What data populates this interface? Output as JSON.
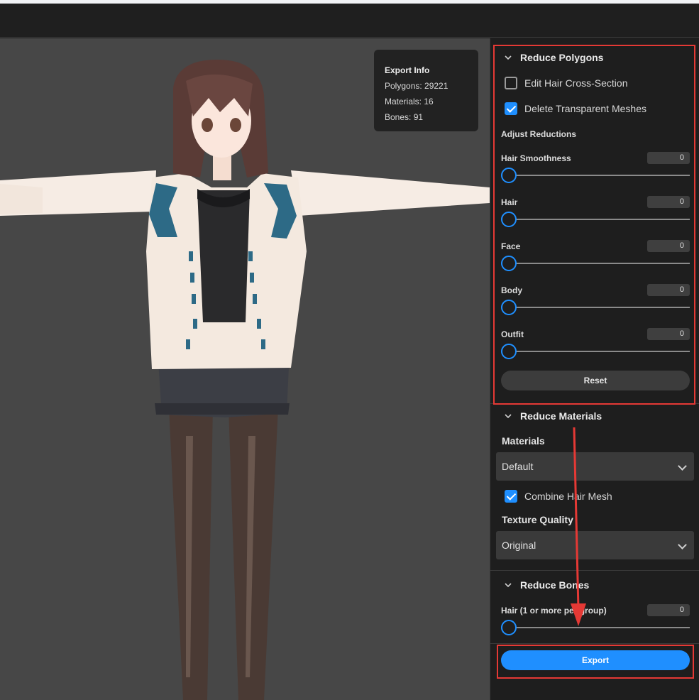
{
  "export_info": {
    "title": "Export Info",
    "polygons": "Polygons: 29221",
    "materials": "Materials: 16",
    "bones": "Bones: 91"
  },
  "reduce_polygons": {
    "title": "Reduce Polygons",
    "edit_hair_cross_section": {
      "label": "Edit Hair Cross-Section",
      "checked": false
    },
    "delete_transparent_meshes": {
      "label": "Delete Transparent Meshes",
      "checked": true
    },
    "adjust_reductions_label": "Adjust Reductions",
    "sliders": [
      {
        "label": "Hair Smoothness",
        "value": "0"
      },
      {
        "label": "Hair",
        "value": "0"
      },
      {
        "label": "Face",
        "value": "0"
      },
      {
        "label": "Body",
        "value": "0"
      },
      {
        "label": "Outfit",
        "value": "0"
      }
    ],
    "reset_label": "Reset"
  },
  "reduce_materials": {
    "title": "Reduce Materials",
    "materials_label": "Materials",
    "materials_value": "Default",
    "combine_hair_mesh": {
      "label": "Combine Hair Mesh",
      "checked": true
    },
    "texture_quality_label": "Texture Quality",
    "texture_quality_value": "Original"
  },
  "reduce_bones": {
    "title": "Reduce Bones",
    "slider": {
      "label": "Hair (1 or more per group)",
      "value": "0"
    }
  },
  "export_label": "Export",
  "colors": {
    "accent": "#1f8fff",
    "highlight": "#e53935",
    "panel_bg": "#1e1e1e",
    "viewport_bg": "#474747"
  },
  "icons": [
    "chevron-down-icon",
    "check-icon",
    "dropdown-caret-icon"
  ]
}
